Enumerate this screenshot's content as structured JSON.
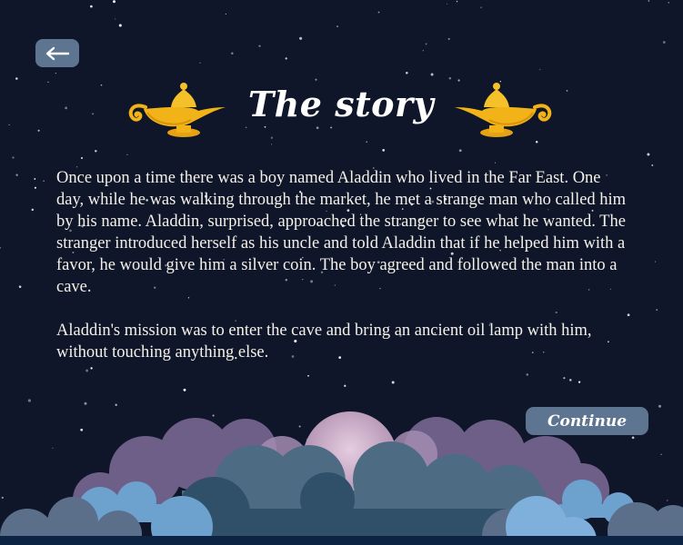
{
  "nav": {
    "back_icon": "arrow-left-icon"
  },
  "header": {
    "title": "The story",
    "left_icon": "magic-lamp-icon",
    "right_icon": "magic-lamp-icon"
  },
  "story": {
    "paragraphs": [
      "Once upon a time there was a boy named Aladdin who lived in the Far East. One day, while he was walking through the market, he met a strange man who called him by his name. Aladdin, surprised, approached the stranger to see what he wanted. The stranger introduced herself as his uncle and told Aladdin that if he helped him with a favor, he would give him a silver coin. The boy agreed and followed the man into a cave.",
      "Aladdin's mission was to enter the cave and bring an ancient oil lamp with him, without touching anything else."
    ]
  },
  "actions": {
    "continue_label": "Continue"
  },
  "colors": {
    "background": "#0f1629",
    "button": "#5d7591",
    "lamp_gold": "#f2b318",
    "text": "#f4f1ea"
  }
}
